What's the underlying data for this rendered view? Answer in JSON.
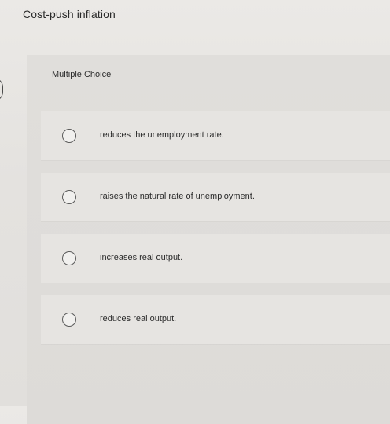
{
  "question": {
    "text": "Cost-push inflation"
  },
  "question_type": {
    "label": "Multiple Choice"
  },
  "options": [
    {
      "label": "reduces the unemployment rate."
    },
    {
      "label": "raises the natural rate of unemployment."
    },
    {
      "label": "increases real output."
    },
    {
      "label": "reduces real output."
    }
  ],
  "icons": {
    "radio": "radio-unchecked-icon"
  },
  "colors": {
    "background": "#e4e2df",
    "panel": "#dddbd8",
    "option_row": "#e6e4e1",
    "text": "#2b2b2b"
  }
}
